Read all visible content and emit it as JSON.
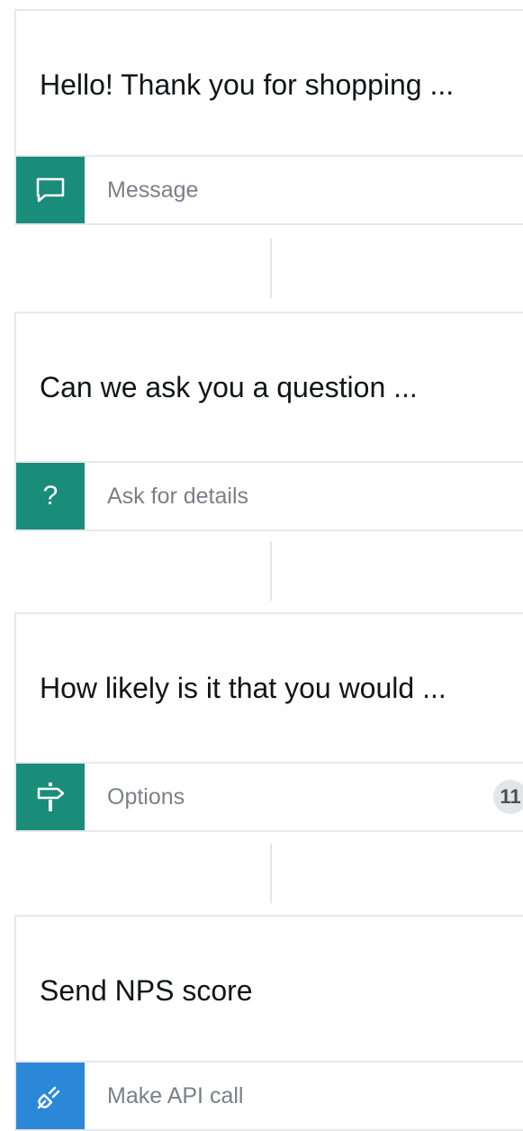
{
  "steps": [
    {
      "title": "Hello! Thank you for shopping ...",
      "type_label": "Message",
      "icon": "speech-bubble-icon",
      "accent": "#1a8c7a"
    },
    {
      "title": "Can we ask you a question ...",
      "type_label": "Ask for details",
      "icon": "question-mark-icon",
      "icon_glyph": "?",
      "accent": "#1a8c7a"
    },
    {
      "title": "How likely is it that you would ...",
      "type_label": "Options",
      "icon": "signpost-icon",
      "count": "11",
      "accent": "#1a8c7a"
    },
    {
      "title": "Send NPS score",
      "type_label": "Make API call",
      "icon": "plug-icon",
      "accent": "#2b87d8"
    }
  ]
}
